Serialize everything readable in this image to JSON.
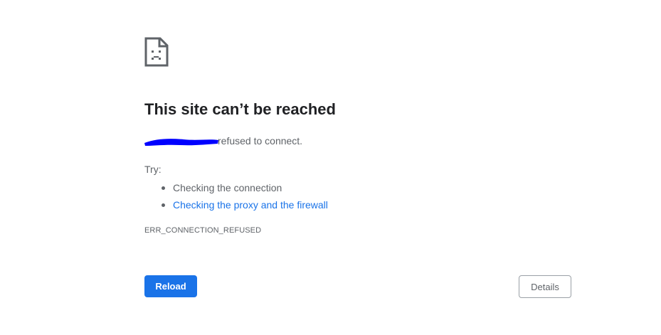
{
  "error": {
    "icon": "sad-page-icon",
    "title": "This site can’t be reached",
    "message_suffix": "refused to connect.",
    "try_label": "Try:",
    "suggestions": [
      {
        "label": "Checking the connection",
        "is_link": false
      },
      {
        "label": "Checking the proxy and the firewall",
        "is_link": true
      }
    ],
    "code": "ERR_CONNECTION_REFUSED"
  },
  "buttons": {
    "reload_label": "Reload",
    "details_label": "Details"
  },
  "colors": {
    "accent": "#1a73e8",
    "text_primary": "#202124",
    "text_secondary": "#5f6368",
    "redaction": "#0000ff"
  }
}
